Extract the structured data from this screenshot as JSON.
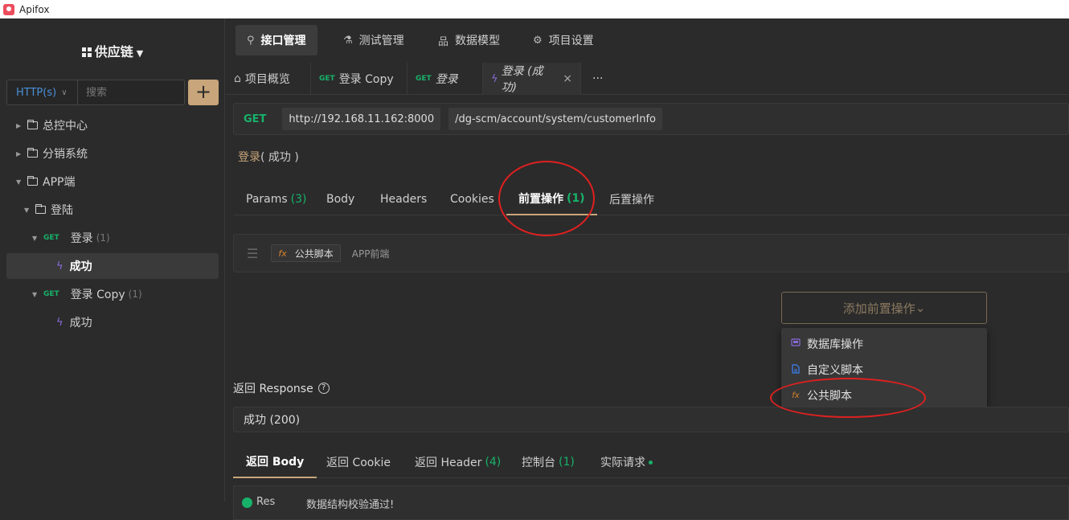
{
  "app": {
    "title": "Apifox"
  },
  "sidebar": {
    "project_name": "供应链",
    "protocol": "HTTP(s)",
    "search_placeholder": "搜索",
    "add_label": "+",
    "tree": [
      {
        "label": "总控中心",
        "type": "folder"
      },
      {
        "label": "分销系统",
        "type": "folder"
      },
      {
        "label": "APP端",
        "type": "folder"
      },
      {
        "label": "登陆",
        "type": "folder"
      },
      {
        "method": "GET",
        "label": "登录",
        "count": "(1)"
      },
      {
        "label": "成功",
        "type": "case"
      },
      {
        "method": "GET",
        "label": "登录 Copy",
        "count": "(1)"
      },
      {
        "label": "成功",
        "type": "case"
      }
    ]
  },
  "topnav": [
    {
      "icon": "⚲",
      "label": "接口管理"
    },
    {
      "icon": "⚗",
      "label": "测试管理"
    },
    {
      "icon": "品",
      "label": "数据模型"
    },
    {
      "icon": "⚙",
      "label": "项目设置"
    }
  ],
  "tabs": {
    "overview": "项目概览",
    "tab2_method": "GET",
    "tab2_label": "登录 Copy",
    "tab3_method": "GET",
    "tab3_label": "登录",
    "tab4_label": "登录 (成功)",
    "close": "×",
    "more": "···"
  },
  "request": {
    "method": "GET",
    "host": "http://192.168.11.162:8000",
    "path": "/dg-scm/account/system/customerInfo"
  },
  "api_name": {
    "main": "登录",
    "sub": "( 成功 )"
  },
  "subtabs": {
    "params": "Params",
    "params_count": "(3)",
    "body": "Body",
    "headers": "Headers",
    "cookies": "Cookies",
    "pre": "前置操作",
    "pre_count": "(1)",
    "post": "后置操作"
  },
  "pre_ops": {
    "drag": "☰",
    "chip_icon": "fx",
    "chip_label": "公共脚本",
    "description": "APP前端",
    "add_button": "添加前置操作",
    "add_chevron": "⌄"
  },
  "dropdown": [
    {
      "icon": "db-icon",
      "label": "数据库操作"
    },
    {
      "icon": "file-icon",
      "label": "自定义脚本"
    },
    {
      "icon": "fx-icon",
      "label": "公共脚本"
    }
  ],
  "response": {
    "title": "返回 Response",
    "help": "?",
    "selected": "成功 (200)"
  },
  "resp_tabs": {
    "body": "返回 Body",
    "cookie": "返回 Cookie",
    "header": "返回 Header",
    "header_count": "(4)",
    "console": "控制台",
    "console_count": "(1)",
    "actual": "实际请求"
  },
  "bottom": {
    "t1": "Res",
    "t2": "数据结构校验通过!"
  },
  "colors": {
    "accent": "#c8a57a",
    "get": "#17b26a",
    "annotation": "#e02020"
  }
}
